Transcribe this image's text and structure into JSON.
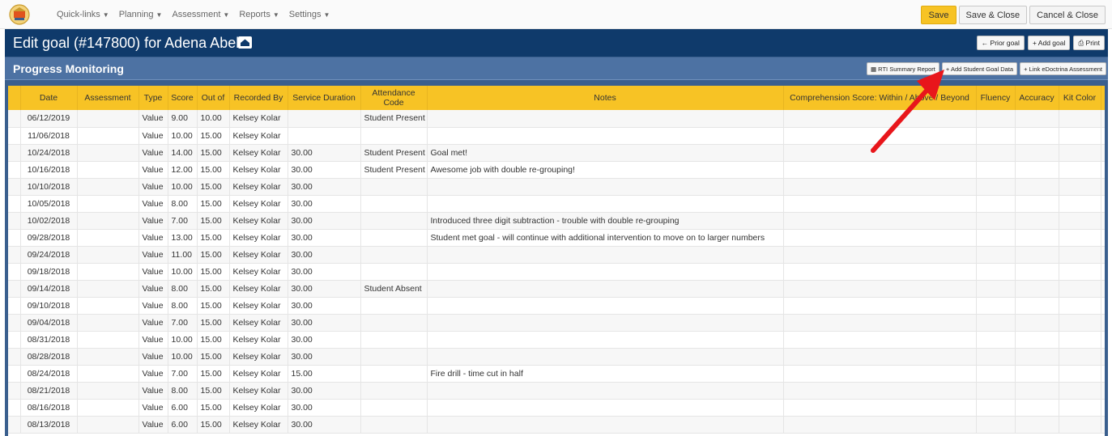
{
  "nav": {
    "items": [
      "Quick-links",
      "Planning",
      "Assessment",
      "Reports",
      "Settings"
    ]
  },
  "top_actions": {
    "save": "Save",
    "save_close": "Save & Close",
    "cancel_close": "Cancel & Close"
  },
  "title": {
    "text": "Edit goal (#147800) for Adena Abell"
  },
  "title_actions": {
    "prior": "← Prior goal",
    "add": "+ Add goal",
    "print": "⎙ Print"
  },
  "section": {
    "title": "Progress Monitoring",
    "rti": "▦ RTI Summary Report",
    "add_data": "+ Add Student Goal Data",
    "link": "+ Link eDoctrina Assessment"
  },
  "table": {
    "headers": [
      "",
      "Date",
      "Assessment",
      "Type",
      "Score",
      "Out of",
      "Recorded By",
      "Service Duration",
      "Attendance Code",
      "Notes",
      "Comprehension Score: Within / Above / Beyond",
      "Fluency",
      "Accuracy",
      "Kit Color",
      ""
    ],
    "rows": [
      [
        "06/12/2019",
        "",
        "Value",
        "9.00",
        "10.00",
        "Kelsey Kolar",
        "",
        "Student Present",
        ""
      ],
      [
        "11/06/2018",
        "",
        "Value",
        "10.00",
        "15.00",
        "Kelsey Kolar",
        "",
        "",
        ""
      ],
      [
        "10/24/2018",
        "",
        "Value",
        "14.00",
        "15.00",
        "Kelsey Kolar",
        "30.00",
        "Student Present",
        "Goal met!"
      ],
      [
        "10/16/2018",
        "",
        "Value",
        "12.00",
        "15.00",
        "Kelsey Kolar",
        "30.00",
        "Student Present",
        "Awesome job with double re-grouping!"
      ],
      [
        "10/10/2018",
        "",
        "Value",
        "10.00",
        "15.00",
        "Kelsey Kolar",
        "30.00",
        "",
        ""
      ],
      [
        "10/05/2018",
        "",
        "Value",
        "8.00",
        "15.00",
        "Kelsey Kolar",
        "30.00",
        "",
        ""
      ],
      [
        "10/02/2018",
        "",
        "Value",
        "7.00",
        "15.00",
        "Kelsey Kolar",
        "30.00",
        "",
        "Introduced three digit subtraction - trouble with double re-grouping"
      ],
      [
        "09/28/2018",
        "",
        "Value",
        "13.00",
        "15.00",
        "Kelsey Kolar",
        "30.00",
        "",
        "Student met goal - will continue with additional intervention to move on to larger numbers"
      ],
      [
        "09/24/2018",
        "",
        "Value",
        "11.00",
        "15.00",
        "Kelsey Kolar",
        "30.00",
        "",
        ""
      ],
      [
        "09/18/2018",
        "",
        "Value",
        "10.00",
        "15.00",
        "Kelsey Kolar",
        "30.00",
        "",
        ""
      ],
      [
        "09/14/2018",
        "",
        "Value",
        "8.00",
        "15.00",
        "Kelsey Kolar",
        "30.00",
        "Student Absent",
        ""
      ],
      [
        "09/10/2018",
        "",
        "Value",
        "8.00",
        "15.00",
        "Kelsey Kolar",
        "30.00",
        "",
        ""
      ],
      [
        "09/04/2018",
        "",
        "Value",
        "7.00",
        "15.00",
        "Kelsey Kolar",
        "30.00",
        "",
        ""
      ],
      [
        "08/31/2018",
        "",
        "Value",
        "10.00",
        "15.00",
        "Kelsey Kolar",
        "30.00",
        "",
        ""
      ],
      [
        "08/28/2018",
        "",
        "Value",
        "10.00",
        "15.00",
        "Kelsey Kolar",
        "30.00",
        "",
        ""
      ],
      [
        "08/24/2018",
        "",
        "Value",
        "7.00",
        "15.00",
        "Kelsey Kolar",
        "15.00",
        "",
        "Fire drill - time cut in half"
      ],
      [
        "08/21/2018",
        "",
        "Value",
        "8.00",
        "15.00",
        "Kelsey Kolar",
        "30.00",
        "",
        ""
      ],
      [
        "08/16/2018",
        "",
        "Value",
        "6.00",
        "15.00",
        "Kelsey Kolar",
        "30.00",
        "",
        ""
      ],
      [
        "08/13/2018",
        "",
        "Value",
        "6.00",
        "15.00",
        "Kelsey Kolar",
        "30.00",
        "",
        ""
      ]
    ]
  },
  "colors": {
    "header_yellow": "#f7c325",
    "title_navy": "#0f3a6b",
    "section_blue": "#4d72a3",
    "arrow_red": "#e8161b"
  }
}
